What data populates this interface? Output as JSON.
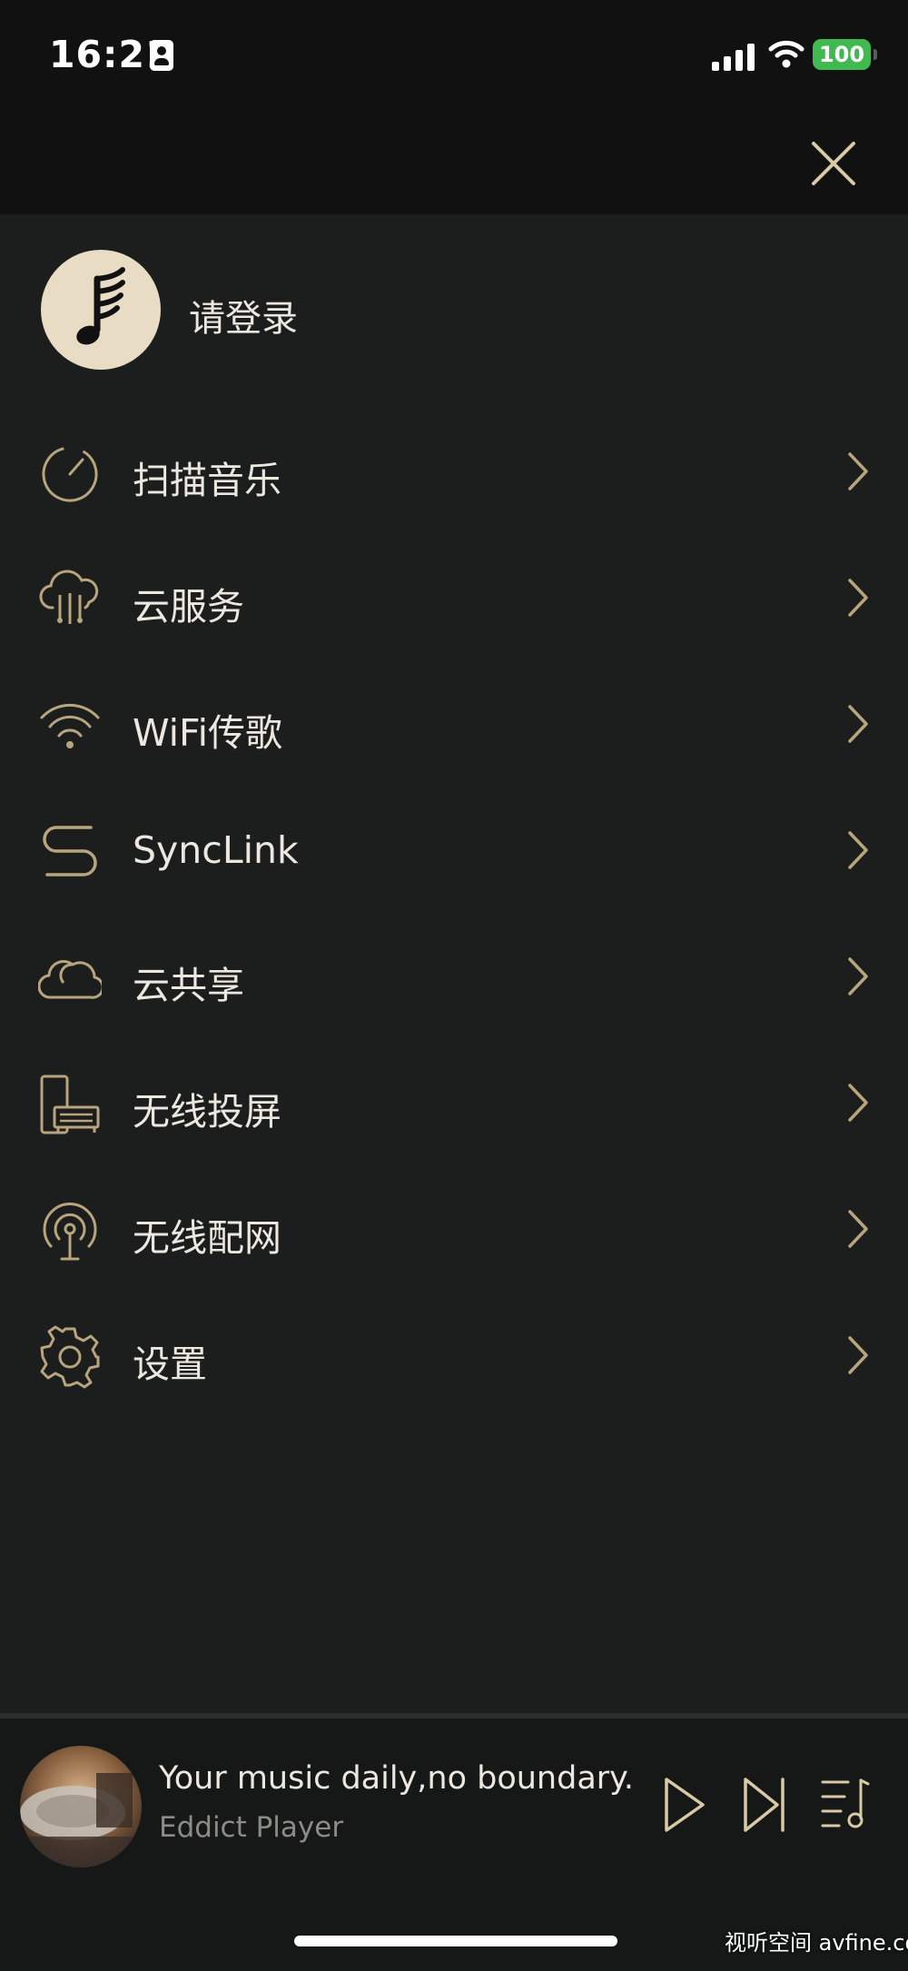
{
  "status_bar": {
    "time": "16:21",
    "battery": "100",
    "icons": [
      "person-badge-icon",
      "signal-icon",
      "wifi-icon",
      "battery-icon"
    ]
  },
  "header": {
    "close_icon": "close-icon"
  },
  "profile": {
    "login_label": "请登录",
    "avatar_icon": "music-note-logo"
  },
  "menu": {
    "items": [
      {
        "label": "扫描音乐",
        "icon": "scan-music-icon"
      },
      {
        "label": "云服务",
        "icon": "cloud-service-icon"
      },
      {
        "label": "WiFi传歌",
        "icon": "wifi-transfer-icon"
      },
      {
        "label": "SyncLink",
        "icon": "synclink-icon"
      },
      {
        "label": "云共享",
        "icon": "cloud-share-icon"
      },
      {
        "label": "无线投屏",
        "icon": "wireless-cast-icon"
      },
      {
        "label": "无线配网",
        "icon": "wireless-network-icon"
      },
      {
        "label": "设置",
        "icon": "settings-icon"
      }
    ]
  },
  "player": {
    "title": "Your music daily,no boundary.",
    "artist": "Eddict Player",
    "controls": [
      "play-icon",
      "next-track-icon",
      "playlist-icon"
    ]
  },
  "watermark": "视听空间 avfine.com",
  "colors": {
    "background": "#1c1d1d",
    "bar": "#111111",
    "accent_gold": "#b9a57d",
    "text": "#ece8e0",
    "battery_green": "#3fb950"
  }
}
